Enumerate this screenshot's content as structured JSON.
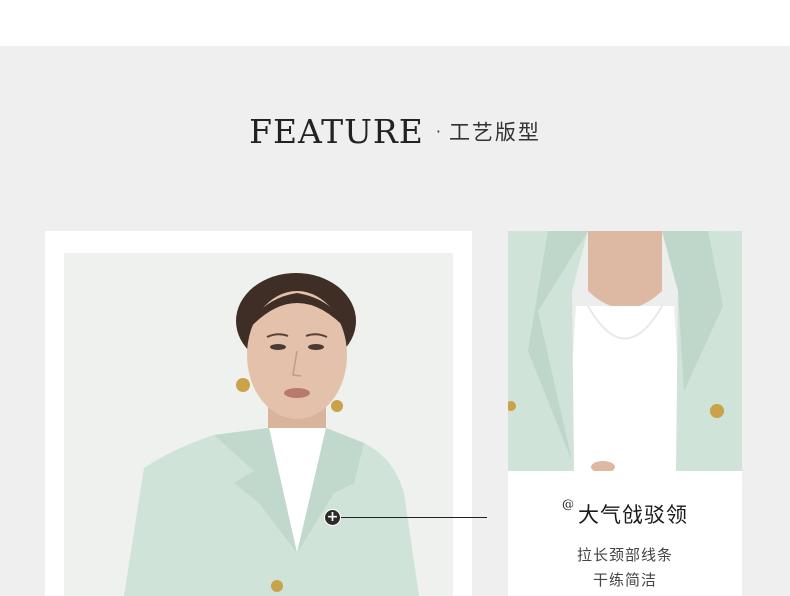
{
  "header": {
    "title_en": "FEATURE",
    "separator": "·",
    "title_cn": "工艺版型"
  },
  "feature": {
    "hotspot_symbol": "+",
    "caption_marker": "@",
    "caption_title": "大气戗驳领",
    "caption_line1": "拉长颈部线条",
    "caption_line2": "干练简洁"
  },
  "colors": {
    "page_background": "#efefef",
    "card_background": "#ffffff",
    "blazer_mint": "#cfe3d9",
    "text_dark": "#222222"
  }
}
